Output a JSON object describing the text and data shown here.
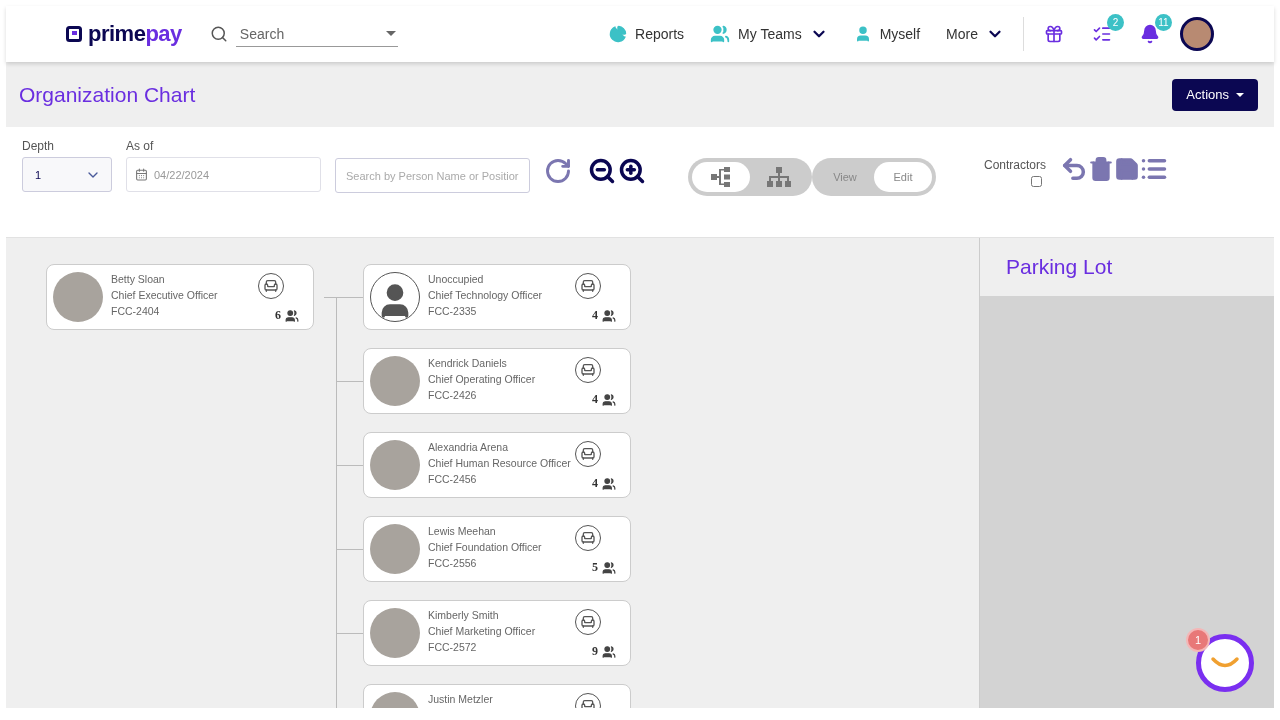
{
  "nav": {
    "logo": {
      "part1": "prime",
      "part2": "pay"
    },
    "search": {
      "placeholder": "Search"
    },
    "links": [
      {
        "kind": "reports",
        "label": "Reports",
        "caret": false
      },
      {
        "kind": "teams",
        "label": "My Teams",
        "caret": true
      },
      {
        "kind": "myself",
        "label": "Myself",
        "caret": false
      },
      {
        "kind": "more",
        "label": "More",
        "caret": true
      }
    ],
    "icons": [
      {
        "kind": "gift"
      },
      {
        "kind": "tasks",
        "badge": "2"
      },
      {
        "kind": "bell",
        "badge": "11"
      }
    ]
  },
  "page": {
    "title": "Organization Chart",
    "actions": "Actions"
  },
  "toolbar": {
    "depth": {
      "label": "Depth",
      "value": "1"
    },
    "as_of": {
      "label": "As of",
      "value": "04/22/2024"
    },
    "search": {
      "placeholder": "Search by Person Name or Positior"
    },
    "layout_toggle": [
      {
        "kind": "horizontal",
        "selected": true
      },
      {
        "kind": "vertical",
        "selected": false
      }
    ],
    "mode_toggle": [
      {
        "label": "View",
        "selected": false
      },
      {
        "label": "Edit",
        "selected": true
      }
    ],
    "contractors": {
      "label": "Contractors",
      "checked": false
    }
  },
  "chart": {
    "name": "Betty Sloan",
    "title": "Chief Executive Officer",
    "code": "FCC-2404",
    "count": "6",
    "photo": true,
    "children": [
      {
        "name": "Unoccupied",
        "title": "Chief Technology Officer",
        "code": "FCC-2335",
        "count": "4",
        "photo": false
      },
      {
        "name": "Kendrick Daniels",
        "title": "Chief Operating Officer",
        "code": "FCC-2426",
        "count": "4",
        "photo": true
      },
      {
        "name": "Alexandria Arena",
        "title": "Chief Human Resource Officer",
        "code": "FCC-2456",
        "count": "4",
        "photo": true
      },
      {
        "name": "Lewis Meehan",
        "title": "Chief Foundation Officer",
        "code": "FCC-2556",
        "count": "5",
        "photo": true
      },
      {
        "name": "Kimberly Smith",
        "title": "Chief Marketing Officer",
        "code": "FCC-2572",
        "count": "9",
        "photo": true
      },
      {
        "name": "Justin Metzler",
        "photo": true
      }
    ]
  },
  "parking_lot": {
    "title": "Parking Lot"
  },
  "chat": {
    "badge": "1"
  }
}
